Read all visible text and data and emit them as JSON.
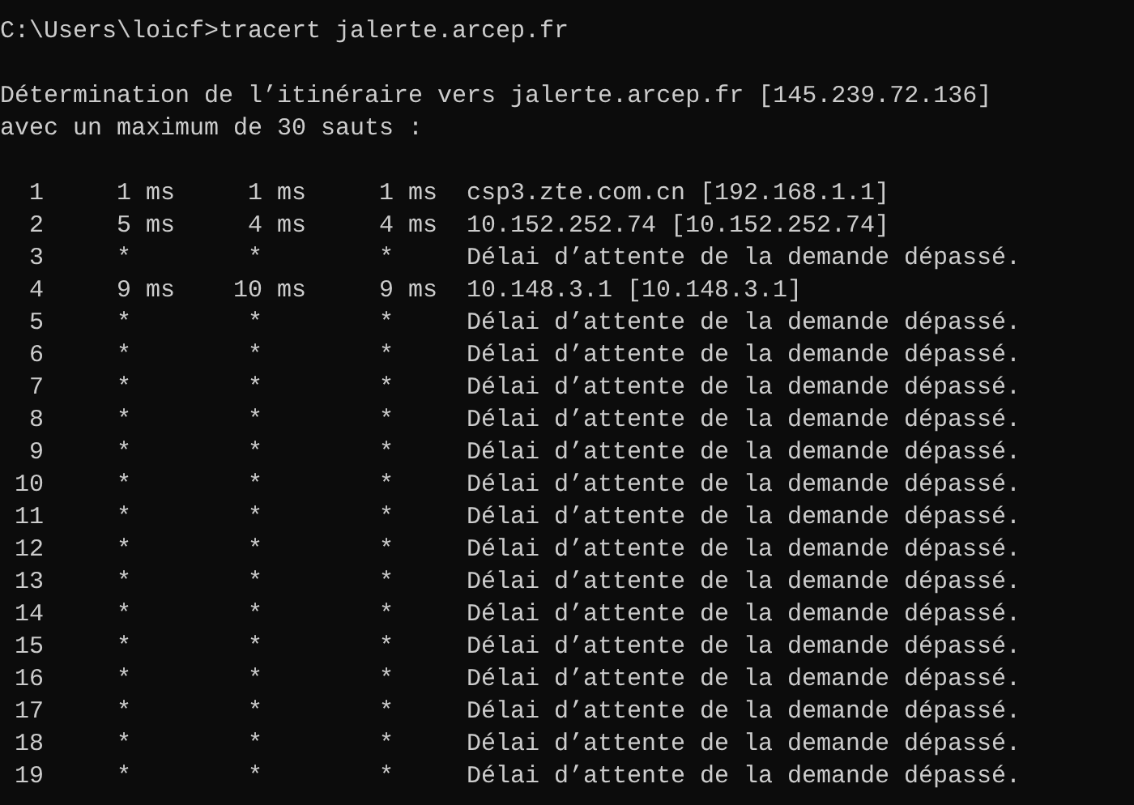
{
  "console": {
    "command_line": "C:\\Users\\loicf>tracert jalerte.arcep.fr",
    "header_lines": [
      "Détermination de l’itinéraire vers jalerte.arcep.fr [145.239.72.136]",
      "avec un maximum de 30 sauts :"
    ],
    "hops": [
      {
        "kind": "reply",
        "hop": "1",
        "times": [
          "1 ms",
          "1 ms",
          "1 ms"
        ],
        "host": "csp3.zte.com.cn [192.168.1.1]"
      },
      {
        "kind": "reply",
        "hop": "2",
        "times": [
          "5 ms",
          "4 ms",
          "4 ms"
        ],
        "host": "10.152.252.74 [10.152.252.74]"
      },
      {
        "kind": "timeout",
        "hop": "3",
        "times": [
          "*",
          "*",
          "*"
        ],
        "host": "Délai d’attente de la demande dépassé."
      },
      {
        "kind": "reply",
        "hop": "4",
        "times": [
          "9 ms",
          "10 ms",
          "9 ms"
        ],
        "host": "10.148.3.1 [10.148.3.1]"
      },
      {
        "kind": "timeout",
        "hop": "5",
        "times": [
          "*",
          "*",
          "*"
        ],
        "host": "Délai d’attente de la demande dépassé."
      },
      {
        "kind": "timeout",
        "hop": "6",
        "times": [
          "*",
          "*",
          "*"
        ],
        "host": "Délai d’attente de la demande dépassé."
      },
      {
        "kind": "timeout",
        "hop": "7",
        "times": [
          "*",
          "*",
          "*"
        ],
        "host": "Délai d’attente de la demande dépassé."
      },
      {
        "kind": "timeout",
        "hop": "8",
        "times": [
          "*",
          "*",
          "*"
        ],
        "host": "Délai d’attente de la demande dépassé."
      },
      {
        "kind": "timeout",
        "hop": "9",
        "times": [
          "*",
          "*",
          "*"
        ],
        "host": "Délai d’attente de la demande dépassé."
      },
      {
        "kind": "timeout",
        "hop": "10",
        "times": [
          "*",
          "*",
          "*"
        ],
        "host": "Délai d’attente de la demande dépassé."
      },
      {
        "kind": "timeout",
        "hop": "11",
        "times": [
          "*",
          "*",
          "*"
        ],
        "host": "Délai d’attente de la demande dépassé."
      },
      {
        "kind": "timeout",
        "hop": "12",
        "times": [
          "*",
          "*",
          "*"
        ],
        "host": "Délai d’attente de la demande dépassé."
      },
      {
        "kind": "timeout",
        "hop": "13",
        "times": [
          "*",
          "*",
          "*"
        ],
        "host": "Délai d’attente de la demande dépassé."
      },
      {
        "kind": "timeout",
        "hop": "14",
        "times": [
          "*",
          "*",
          "*"
        ],
        "host": "Délai d’attente de la demande dépassé."
      },
      {
        "kind": "timeout",
        "hop": "15",
        "times": [
          "*",
          "*",
          "*"
        ],
        "host": "Délai d’attente de la demande dépassé."
      },
      {
        "kind": "timeout",
        "hop": "16",
        "times": [
          "*",
          "*",
          "*"
        ],
        "host": "Délai d’attente de la demande dépassé."
      },
      {
        "kind": "timeout",
        "hop": "17",
        "times": [
          "*",
          "*",
          "*"
        ],
        "host": "Délai d’attente de la demande dépassé."
      },
      {
        "kind": "timeout",
        "hop": "18",
        "times": [
          "*",
          "*",
          "*"
        ],
        "host": "Délai d’attente de la demande dépassé."
      },
      {
        "kind": "timeout",
        "hop": "19",
        "times": [
          "*",
          "*",
          "*"
        ],
        "host": "Délai d’attente de la demande dépassé."
      }
    ]
  }
}
